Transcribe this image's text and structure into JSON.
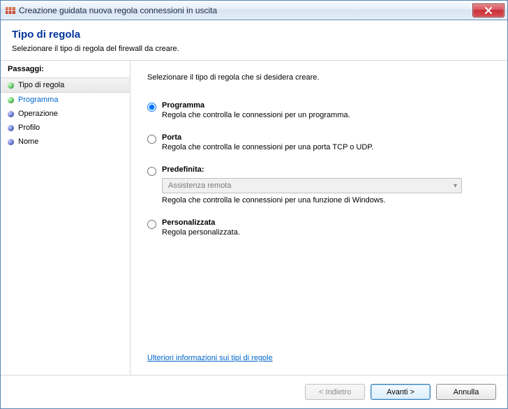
{
  "window": {
    "title": "Creazione guidata nuova regola connessioni in uscita"
  },
  "header": {
    "title": "Tipo di regola",
    "subtitle": "Selezionare il tipo di regola del firewall da creare."
  },
  "sidebar": {
    "heading": "Passaggi:",
    "items": [
      {
        "label": "Tipo di regola",
        "state": "current"
      },
      {
        "label": "Programma",
        "state": "next"
      },
      {
        "label": "Operazione",
        "state": "pending"
      },
      {
        "label": "Profilo",
        "state": "pending"
      },
      {
        "label": "Nome",
        "state": "pending"
      }
    ]
  },
  "main": {
    "intro": "Selezionare il tipo di regola che si desidera creare.",
    "options": [
      {
        "id": "programma",
        "label": "Programma",
        "desc": "Regola che controlla le connessioni per un programma.",
        "checked": true
      },
      {
        "id": "porta",
        "label": "Porta",
        "desc": "Regola che controlla le connessioni per una porta TCP o UDP.",
        "checked": false
      },
      {
        "id": "predefinita",
        "label": "Predefinita:",
        "dropdown_value": "Assistenza remota",
        "desc": "Regola che controlla le connessioni per una funzione di Windows.",
        "checked": false
      },
      {
        "id": "personalizzata",
        "label": "Personalizzata",
        "desc": "Regola personalizzata.",
        "checked": false
      }
    ],
    "more_link": "Ulteriori informazioni sui tipi di regole"
  },
  "footer": {
    "back": "< Indietro",
    "next": "Avanti >",
    "cancel": "Annulla"
  }
}
